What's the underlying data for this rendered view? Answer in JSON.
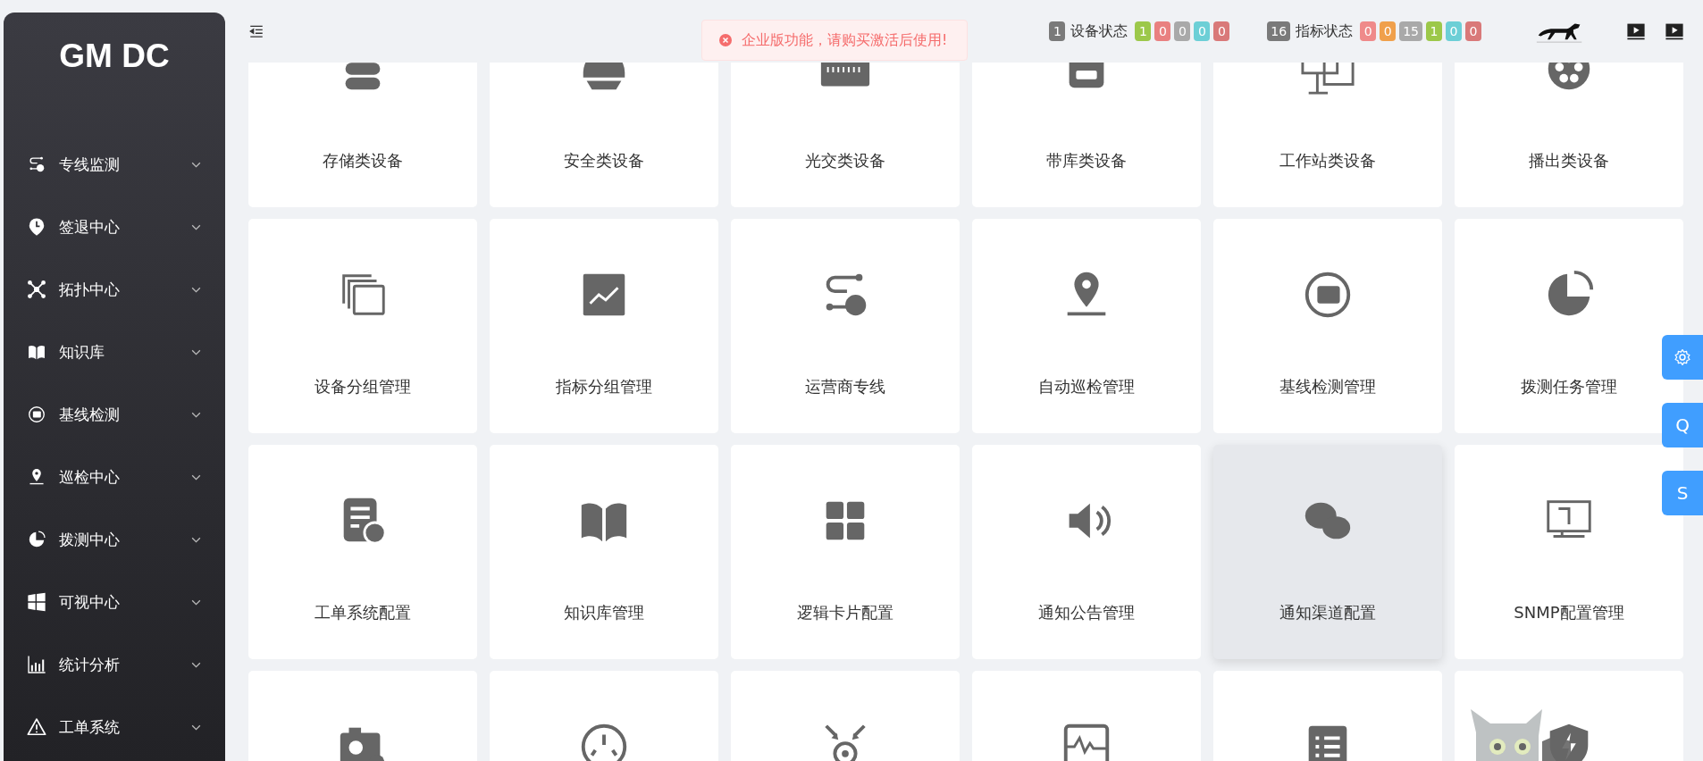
{
  "sidebar": {
    "logo": "GM DC",
    "items": [
      {
        "label": "专线监测",
        "expanded": false
      },
      {
        "label": "签退中心",
        "expanded": false
      },
      {
        "label": "拓扑中心",
        "expanded": false
      },
      {
        "label": "知识库",
        "expanded": false
      },
      {
        "label": "基线检测",
        "expanded": false
      },
      {
        "label": "巡检中心",
        "expanded": false
      },
      {
        "label": "拨测中心",
        "expanded": false
      },
      {
        "label": "可视中心",
        "expanded": false
      },
      {
        "label": "统计分析",
        "expanded": false
      },
      {
        "label": "工单系统",
        "expanded": false
      }
    ]
  },
  "toast": {
    "message": "企业版功能，请购买激活后使用!"
  },
  "status_groups": [
    {
      "count": "1",
      "label": "设备状态",
      "badges": [
        {
          "text": "1",
          "color": "#9cc84a"
        },
        {
          "text": "0",
          "color": "#e98080"
        },
        {
          "text": "0",
          "color": "#a9a9a9"
        },
        {
          "text": "0",
          "color": "#6ccfd6"
        },
        {
          "text": "0",
          "color": "#d97979"
        }
      ]
    },
    {
      "count": "16",
      "label": "指标状态",
      "badges": [
        {
          "text": "0",
          "color": "#ef8a8a"
        },
        {
          "text": "0",
          "color": "#f0a04b"
        },
        {
          "text": "15",
          "color": "#a9a9a9"
        },
        {
          "text": "1",
          "color": "#9cc84a"
        },
        {
          "text": "0",
          "color": "#6ccfd6"
        },
        {
          "text": "0",
          "color": "#d97979"
        }
      ]
    }
  ],
  "cards": [
    {
      "label": "存储类设备",
      "highlighted": false
    },
    {
      "label": "安全类设备",
      "highlighted": false
    },
    {
      "label": "光交类设备",
      "highlighted": false
    },
    {
      "label": "带库类设备",
      "highlighted": false
    },
    {
      "label": "工作站类设备",
      "highlighted": false
    },
    {
      "label": "播出类设备",
      "highlighted": false
    },
    {
      "label": "设备分组管理",
      "highlighted": false
    },
    {
      "label": "指标分组管理",
      "highlighted": false
    },
    {
      "label": "运营商专线",
      "highlighted": false
    },
    {
      "label": "自动巡检管理",
      "highlighted": false
    },
    {
      "label": "基线检测管理",
      "highlighted": false
    },
    {
      "label": "拨测任务管理",
      "highlighted": false
    },
    {
      "label": "工单系统配置",
      "highlighted": false
    },
    {
      "label": "知识库管理",
      "highlighted": false
    },
    {
      "label": "逻辑卡片配置",
      "highlighted": false
    },
    {
      "label": "通知公告管理",
      "highlighted": false
    },
    {
      "label": "通知渠道配置",
      "highlighted": true
    },
    {
      "label": "SNMP配置管理",
      "highlighted": false
    },
    {
      "highlighted": false
    },
    {
      "highlighted": false
    },
    {
      "highlighted": false
    },
    {
      "highlighted": false
    },
    {
      "highlighted": false
    },
    {
      "highlighted": false
    }
  ],
  "side_buttons": [
    {
      "text": "Q"
    },
    {
      "text": "S"
    }
  ]
}
